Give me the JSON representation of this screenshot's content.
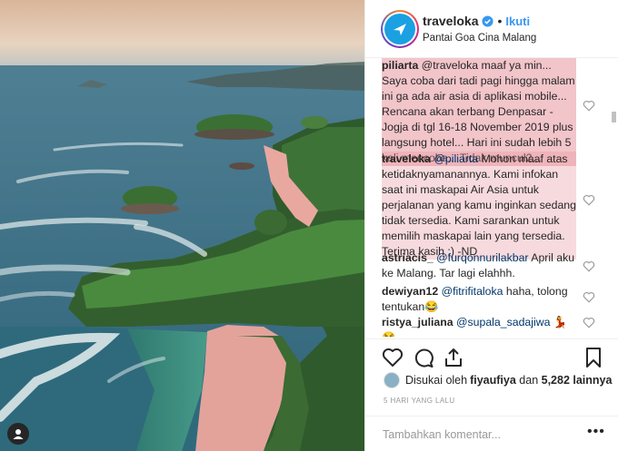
{
  "post": {
    "username": "traveloka",
    "separator": "•",
    "follow_label": "Ikuti",
    "location": "Pantai Goa Cina Malang"
  },
  "comments": [
    {
      "user": "piliarta",
      "text": "@traveloka maaf ya min... Saya coba dari tadi pagi hingga malam ini ga ada air asia di aplikasi mobile... Rencana akan terbang Denpasar - Jogja di tgl 16-18 November 2019 plus langsung hotel... Hari ini sudah lebih 5 kali mencoba... Tidak muncul2..."
    },
    {
      "user": "traveloka",
      "mention": "@piliarta",
      "text": " Mohon maaf atas ketidaknyamanannya. Kami infokan saat ini maskapai Air Asia untuk perjalanan yang kamu inginkan sedang tidak tersedia. Kami sarankan untuk memilih maskapai lain yang tersedia. Terima kasih :) -ND"
    },
    {
      "user": "astriacis_",
      "mention": "@furqonnurilakbar",
      "text": " April aku ke Malang. Tar lagi elahhh."
    },
    {
      "user": "dewiyan12",
      "mention": "@fitrifitaloka",
      "text": " haha, tolong tentukan😂"
    },
    {
      "user": "ristya_juliana",
      "mention": "@supala_sadajiwa",
      "text": " 💃😂"
    }
  ],
  "likes": {
    "prefix": "Disukai oleh ",
    "first_user": "fiyaufiya",
    "middle": " dan ",
    "count_text": "5,282 lainnya"
  },
  "timestamp": "5 HARI YANG LALU",
  "comment_input": {
    "placeholder": "Tambahkan komentar..."
  },
  "more_label": "•••",
  "icons": [
    "heart-icon",
    "comment-icon",
    "share-icon",
    "bookmark-icon",
    "verified-icon",
    "more-options-icon",
    "tagged-user-icon"
  ],
  "colors": {
    "accent": "#3897f0",
    "highlight": "#e8969e",
    "brand": "#1ba0e2"
  }
}
